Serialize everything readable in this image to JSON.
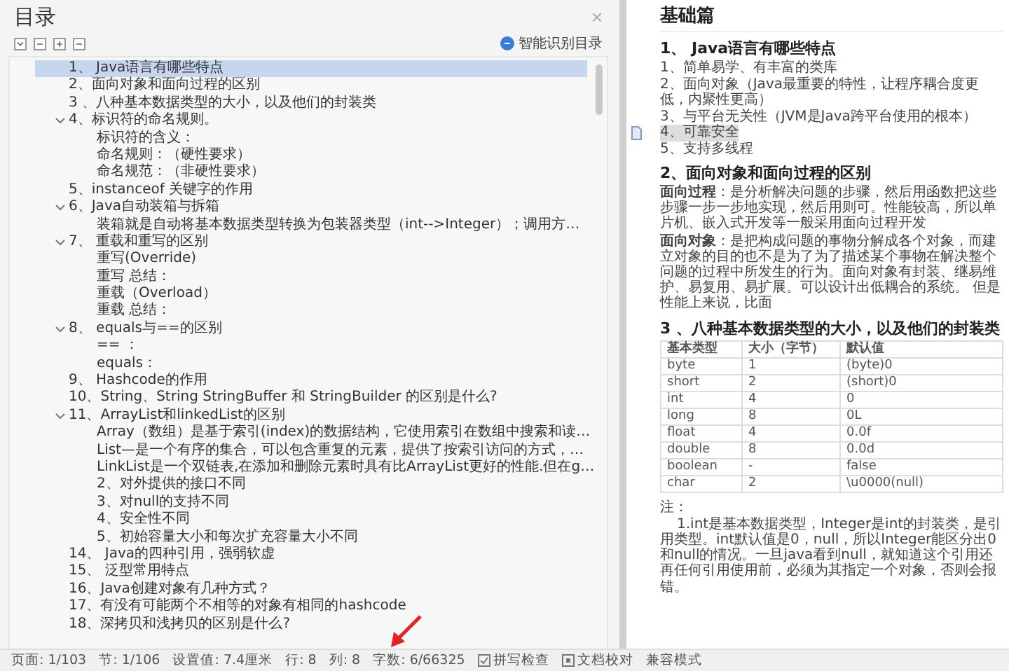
{
  "toc_panel": {
    "title": "目录",
    "close": "×",
    "smart_button": "智能识别目录",
    "items": [
      {
        "label": "1、 Java语言有哪些特点",
        "selected": true
      },
      {
        "label": "2、面向对象和面向过程的区别",
        "selected": false
      },
      {
        "label": "3 、八种基本数据类型的大小，以及他们的封装类",
        "selected": false
      },
      {
        "label": "4、标识符的命名规则。",
        "selected": false,
        "expanded": true,
        "children": [
          {
            "label": "标识符的含义：",
            "selected": false
          },
          {
            "label": "命名规则：（硬性要求）",
            "selected": false
          },
          {
            "label": "命名规范：（非硬性要求）",
            "selected": false
          }
        ]
      },
      {
        "label": "5、instanceof 关键字的作用",
        "selected": false
      },
      {
        "label": "6、Java自动装箱与拆箱",
        "selected": false,
        "expanded": true,
        "children": [
          {
            "label": "装箱就是自动将基本数据类型转换为包装器类型（int-->Integer）；调用方…",
            "selected": false
          }
        ]
      },
      {
        "label": "7、 重载和重写的区别",
        "selected": false,
        "expanded": true,
        "children": [
          {
            "label": "重写(Override)",
            "selected": false
          },
          {
            "label": "重写 总结：",
            "selected": false
          },
          {
            "label": "重载（Overload）",
            "selected": false
          },
          {
            "label": "重载 总结：",
            "selected": false
          }
        ]
      },
      {
        "label": "8、 equals与==的区别",
        "selected": false,
        "expanded": true,
        "children": [
          {
            "label": "== ：",
            "selected": false
          },
          {
            "label": "equals：",
            "selected": false
          }
        ]
      },
      {
        "label": "9、 Hashcode的作用",
        "selected": false
      },
      {
        "label": "10、String、String StringBuffer 和 StringBuilder 的区别是什么?",
        "selected": false
      },
      {
        "label": "11、ArrayList和linkedList的区别",
        "selected": false,
        "expanded": true,
        "children": [
          {
            "label": "Array（数组）是基于索引(index)的数据结构，它使用索引在数组中搜索和读…",
            "selected": false
          },
          {
            "label": "List—是一个有序的集合，可以包含重复的元素，提供了按索引访问的方式，…",
            "selected": false
          },
          {
            "label": "LinkList是一个双链表,在添加和删除元素时具有比ArrayList更好的性能.但在g…",
            "selected": false
          },
          {
            "label": "2、对外提供的接口不同",
            "selected": false
          },
          {
            "label": "3、对null的支持不同",
            "selected": false
          },
          {
            "label": "4、安全性不同",
            "selected": false
          },
          {
            "label": "5、初始容量大小和每次扩充容量大小不同",
            "selected": false
          }
        ]
      },
      {
        "label": "14、 Java的四种引用，强弱软虚",
        "selected": false
      },
      {
        "label": "15、 泛型常用特点",
        "selected": false
      },
      {
        "label": "16、Java创建对象有几种方式？",
        "selected": false
      },
      {
        "label": "17、有没有可能两个不相等的对象有相同的hashcode",
        "selected": false
      },
      {
        "label": "18、深拷贝和浅拷贝的区别是什么?",
        "selected": false
      }
    ]
  },
  "document": {
    "title": "基础篇",
    "sections": [
      {
        "kind": "list",
        "heading": "1、 Java语言有哪些特点",
        "items": [
          {
            "text": "1、简单易学、有丰富的类库",
            "highlighted": false
          },
          {
            "text": "2、面向对象（Java最重要的特性，让程序耦合度更低，内聚性更高）",
            "highlighted": false
          },
          {
            "text": "3、与平台无关性（JVM是Java跨平台使用的根本）",
            "highlighted": false
          },
          {
            "text": "4、可靠安全",
            "highlighted": true
          },
          {
            "text": "5、支持多线程",
            "highlighted": false
          }
        ]
      },
      {
        "kind": "paragraphs",
        "heading": "2、面向对象和面向过程的区别",
        "paragraphs": [
          "**面向过程**：是分析解决问题的步骤，然后用函数把这些步骤一步一步地实现，然后用则可。性能较高，所以单片机、嵌入式开发等一般采用面向过程开发",
          "**面向对象**：是把构成问题的事物分解成各个对象，而建立对象的目的也不是为了为了描述某个事物在解决整个问题的过程中所发生的行为。面向对象有封装、继易维护、易复用、易扩展。可以设计出低耦合的系统。 但是性能上来说，比面"
        ]
      },
      {
        "kind": "table",
        "heading": "3 、八种基本数据类型的大小，以及他们的封装类",
        "columns": [
          "基本类型",
          "大小（字节）",
          "默认值"
        ],
        "rows": [
          [
            "byte",
            "1",
            "(byte)0"
          ],
          [
            "short",
            "2",
            "(short)0"
          ],
          [
            "int",
            "4",
            "0"
          ],
          [
            "long",
            "8",
            "0L"
          ],
          [
            "float",
            "4",
            "0.0f"
          ],
          [
            "double",
            "8",
            "0.0d"
          ],
          [
            "boolean",
            "-",
            "false"
          ],
          [
            "char",
            "2",
            "\\u0000(null)"
          ]
        ]
      },
      {
        "kind": "note",
        "heading": "注：",
        "paragraphs": [
          "1.int是基本数据类型，Integer是int的封装类，是引用类型。int默认值是0，null，所以Integer能区分出0和null的情况。一旦java看到null，就知道这个引用还再任何引用使用前，必须为其指定一个对象，否则会报错。"
        ]
      }
    ]
  },
  "status_bar": {
    "items": [
      "页面: 1/103",
      "节: 1/106",
      "设置值: 7.4厘米",
      "行: 8",
      "列: 8",
      "字数: 6/66325"
    ],
    "buttons": [
      {
        "kind": "check",
        "label": "拼写检查"
      },
      {
        "kind": "proof",
        "label": "文档校对"
      },
      {
        "kind": "plain",
        "label": "兼容模式"
      }
    ]
  }
}
